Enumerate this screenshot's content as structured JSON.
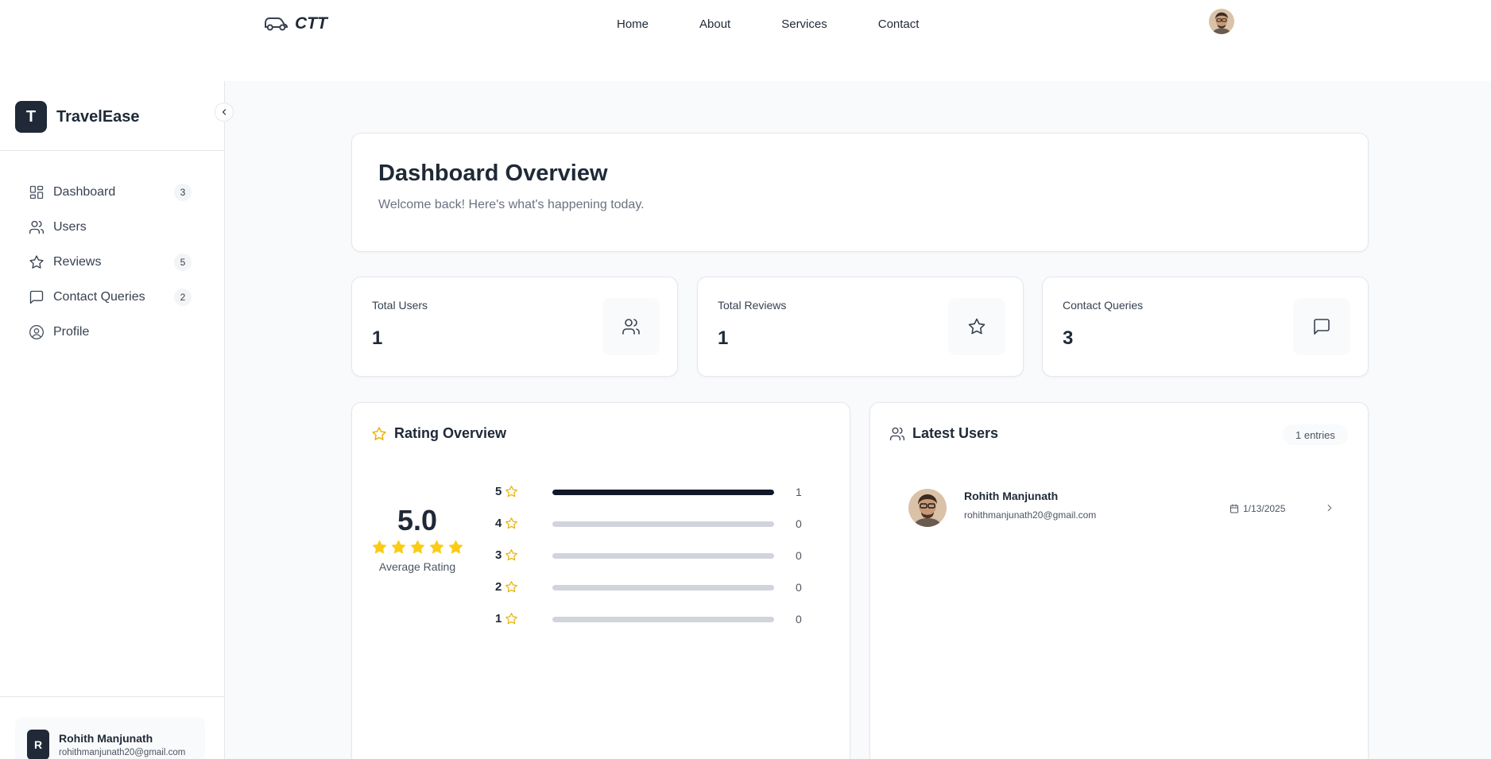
{
  "topnav": {
    "brand": "CTT",
    "links": [
      "Home",
      "About",
      "Services",
      "Contact"
    ]
  },
  "sidebar": {
    "logo_letter": "T",
    "title": "TravelEase",
    "items": [
      {
        "label": "Dashboard",
        "icon": "grid-icon",
        "count": "3"
      },
      {
        "label": "Users",
        "icon": "users-icon",
        "count": ""
      },
      {
        "label": "Reviews",
        "icon": "star-icon",
        "count": "5"
      },
      {
        "label": "Contact Queries",
        "icon": "message-icon",
        "count": "2"
      },
      {
        "label": "Profile",
        "icon": "user-circle-icon",
        "count": ""
      }
    ],
    "user": {
      "initial": "R",
      "name": "Rohith Manjunath",
      "email": "rohithmanjunath20@gmail.com"
    }
  },
  "header": {
    "title": "Dashboard Overview",
    "subtitle": "Welcome back! Here's what's happening today."
  },
  "stats": [
    {
      "label": "Total Users",
      "value": "1",
      "icon": "users-icon"
    },
    {
      "label": "Total Reviews",
      "value": "1",
      "icon": "star-icon"
    },
    {
      "label": "Contact Queries",
      "value": "3",
      "icon": "message-icon"
    }
  ],
  "rating": {
    "title": "Rating Overview",
    "average": "5.0",
    "average_label": "Average Rating",
    "breakdown": [
      {
        "stars": "5",
        "count": "1",
        "fraction": 1.0
      },
      {
        "stars": "4",
        "count": "0",
        "fraction": 0
      },
      {
        "stars": "3",
        "count": "0",
        "fraction": 0
      },
      {
        "stars": "2",
        "count": "0",
        "fraction": 0
      },
      {
        "stars": "1",
        "count": "0",
        "fraction": 0
      }
    ]
  },
  "latest_users": {
    "title": "Latest Users",
    "entries_label": "1 entries",
    "users": [
      {
        "name": "Rohith Manjunath",
        "email": "rohithmanjunath20@gmail.com",
        "date": "1/13/2025"
      }
    ]
  },
  "colors": {
    "star": "#facc15",
    "dark": "#1f2937",
    "bar_fill": "#111827",
    "bar_track": "#d1d5db"
  }
}
